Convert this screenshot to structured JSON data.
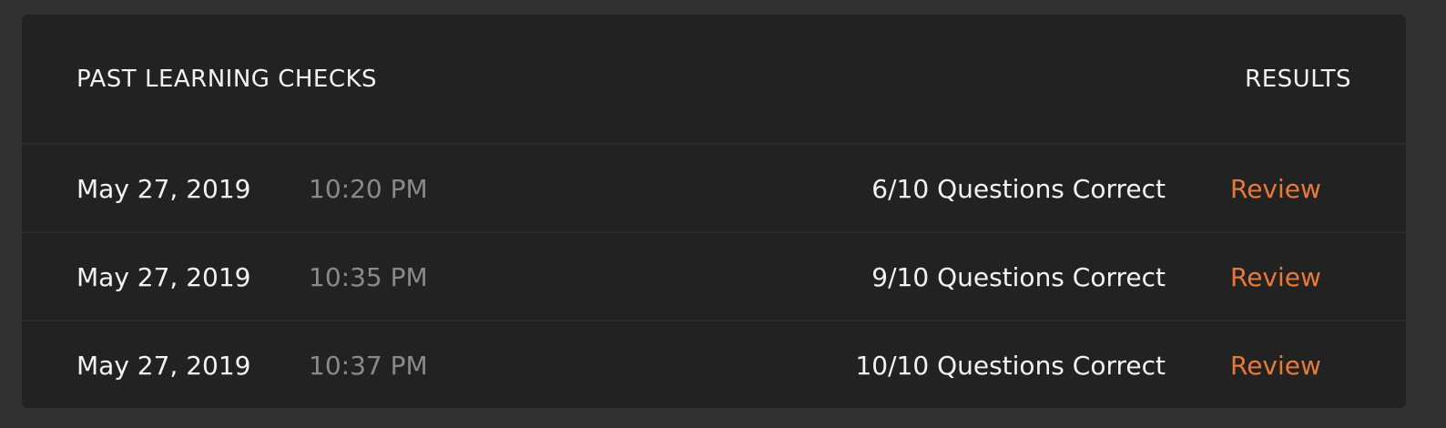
{
  "colors": {
    "background": "#323232",
    "panel": "#222222",
    "divider": "#2b2b2b",
    "primary_text": "#f3f3f3",
    "muted_text": "#8a8a8a",
    "accent_link": "#e8793a"
  },
  "header": {
    "title": "PAST LEARNING CHECKS",
    "results_label": "RESULTS"
  },
  "rows": [
    {
      "date": "May 27, 2019",
      "time": "10:20 PM",
      "score": "6/10 Questions Correct",
      "action": "Review"
    },
    {
      "date": "May 27, 2019",
      "time": "10:35 PM",
      "score": "9/10 Questions Correct",
      "action": "Review"
    },
    {
      "date": "May 27, 2019",
      "time": "10:37 PM",
      "score": "10/10 Questions Correct",
      "action": "Review"
    }
  ]
}
